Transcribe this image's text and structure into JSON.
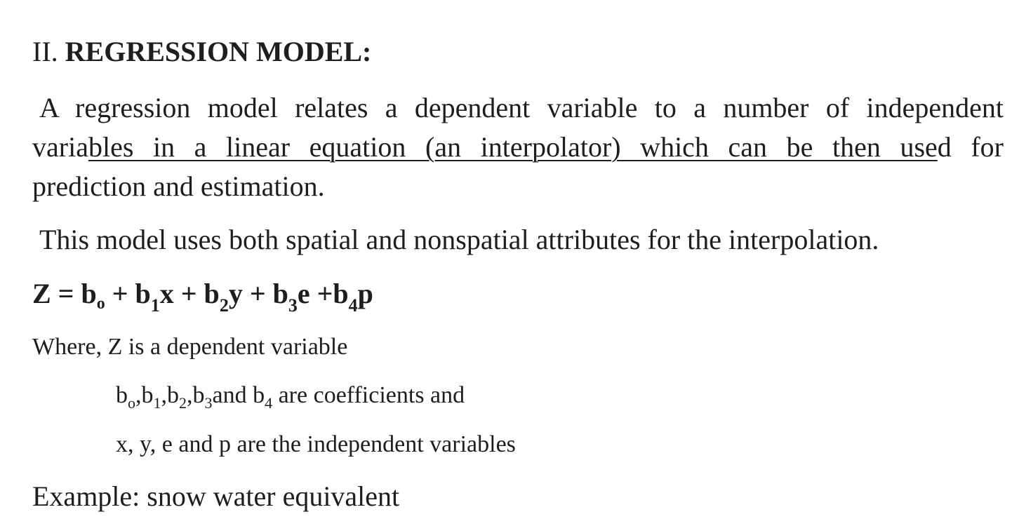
{
  "heading": {
    "number": "II.",
    "title": "REGRESSION MODEL:"
  },
  "intro": {
    "line1": "A regression model relates a dependent variable to a number of independent",
    "line2_start": "varia",
    "line2_underlined": "bles in a linear equation (an interpolator) which can be then use",
    "line2_end": "d for",
    "line3": "prediction and estimation."
  },
  "attributes_sentence": "This model uses both spatial and nonspatial attributes for the interpolation.",
  "equation": {
    "lhs": "Z = b",
    "sub0": "o",
    "t1": " + b",
    "sub1": "1",
    "t2": "x + b",
    "sub2": "2",
    "t3": "y + b",
    "sub3": "3",
    "t4": "e +b",
    "sub4": "4",
    "t5": "p"
  },
  "where_line": "Where, Z is a dependent variable",
  "coefficients_line": {
    "b0": "b",
    "sub0": "o",
    "b1": ",b",
    "sub1": "1",
    "b2": ",b",
    "sub2": "2",
    "b3": ",b",
    "sub3": "3",
    "and_b4": "and b",
    "sub4": "4",
    "tail": " are coefficients and"
  },
  "independent_line": "x, y, e and p are the independent variables",
  "example_line": "Example: snow water equivalent"
}
